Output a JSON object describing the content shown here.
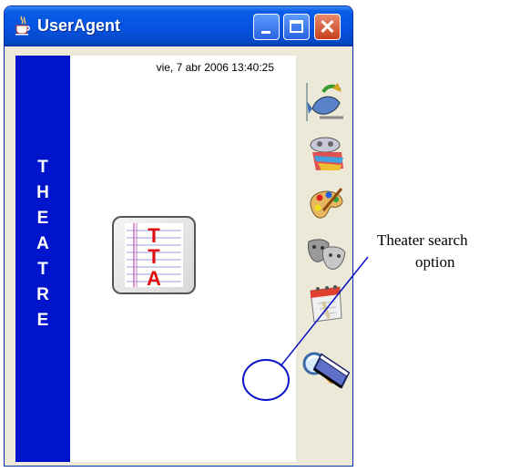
{
  "window": {
    "title": "UserAgent",
    "controls": {
      "minimize": "minimize",
      "maximize": "maximize",
      "close": "✕"
    }
  },
  "banner": {
    "letters": [
      "T",
      "H",
      "E",
      "A",
      "T",
      "R",
      "E"
    ]
  },
  "content": {
    "datetime": "vie, 7 abr 2006 13:40:25"
  },
  "toolbar": {
    "items": [
      {
        "icon": "fish-food-icon"
      },
      {
        "icon": "film-reel-icon"
      },
      {
        "icon": "art-palette-icon"
      },
      {
        "icon": "theater-masks-icon"
      },
      {
        "icon": "calendar-icon"
      },
      {
        "icon": "search-magnifier-icon"
      },
      {
        "icon": "folder-icon"
      }
    ]
  },
  "annotation": {
    "line1": "Theater search",
    "line2": "option",
    "color": "#0a14c8"
  },
  "colors": {
    "banner": "#0014cc",
    "titlebar": "#0553e0"
  }
}
